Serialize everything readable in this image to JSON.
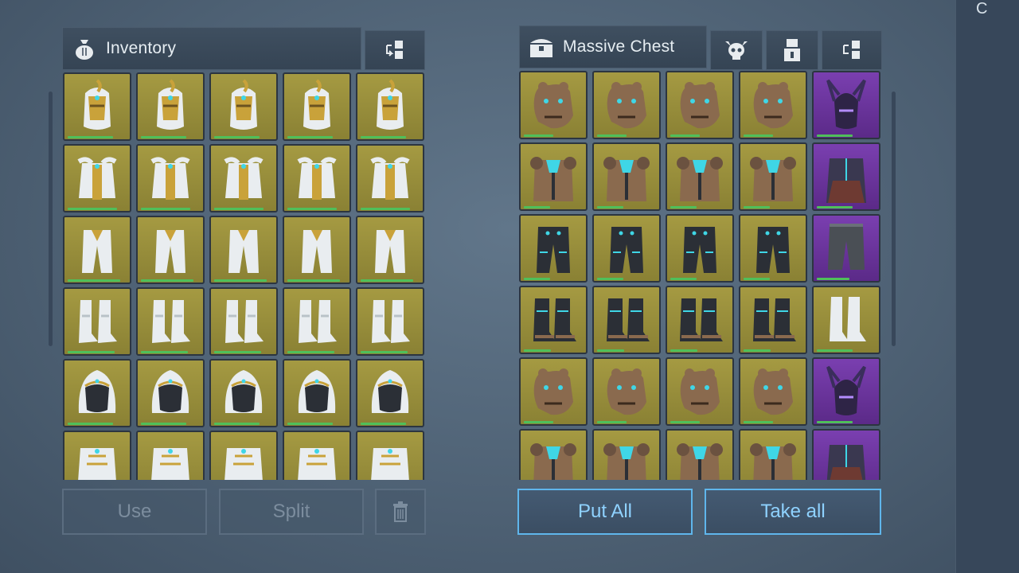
{
  "inventory": {
    "title": "Inventory",
    "icon": "money-bag-icon",
    "transfer_icon": "transfer-icon",
    "rows": [
      [
        "helmet",
        "helmet",
        "helmet",
        "helmet",
        "helmet"
      ],
      [
        "chest",
        "chest",
        "chest",
        "chest",
        "chest"
      ],
      [
        "pants",
        "pants",
        "pants",
        "pants",
        "pants"
      ],
      [
        "boots",
        "boots",
        "boots",
        "boots",
        "boots"
      ],
      [
        "hood",
        "hood",
        "hood",
        "hood",
        "hood"
      ],
      [
        "robe",
        "robe",
        "robe",
        "robe",
        "robe"
      ]
    ],
    "buttons": {
      "use": "Use",
      "split": "Split",
      "delete_icon": "trash-icon"
    }
  },
  "chest": {
    "title": "Massive Chest",
    "icon": "chest-icon",
    "header_icons": [
      "clan-skull-icon",
      "access-icon",
      "transfer-icon"
    ],
    "rows": [
      [
        "bear-head",
        "bear-head",
        "bear-head",
        "bear-head",
        "purple-helm"
      ],
      [
        "bear-chest",
        "bear-chest",
        "bear-chest",
        "bear-chest",
        "purple-chest"
      ],
      [
        "bear-pants",
        "bear-pants",
        "bear-pants",
        "bear-pants",
        "grey-pants"
      ],
      [
        "bear-boots",
        "bear-boots",
        "bear-boots",
        "bear-boots",
        "white-boots"
      ],
      [
        "bear-head",
        "bear-head",
        "bear-head",
        "bear-head",
        "purple-helm"
      ],
      [
        "bear-chest",
        "bear-chest",
        "bear-chest",
        "bear-chest",
        "purple-chest"
      ]
    ],
    "buttons": {
      "put_all": "Put All",
      "take_all": "Take all"
    }
  },
  "right_strip_glyph": "C",
  "colors": {
    "slot_gold": "#a59a42",
    "slot_purple": "#7a3fb0",
    "durability": "#4fbf5a",
    "button_accent": "#5fb6ec"
  }
}
